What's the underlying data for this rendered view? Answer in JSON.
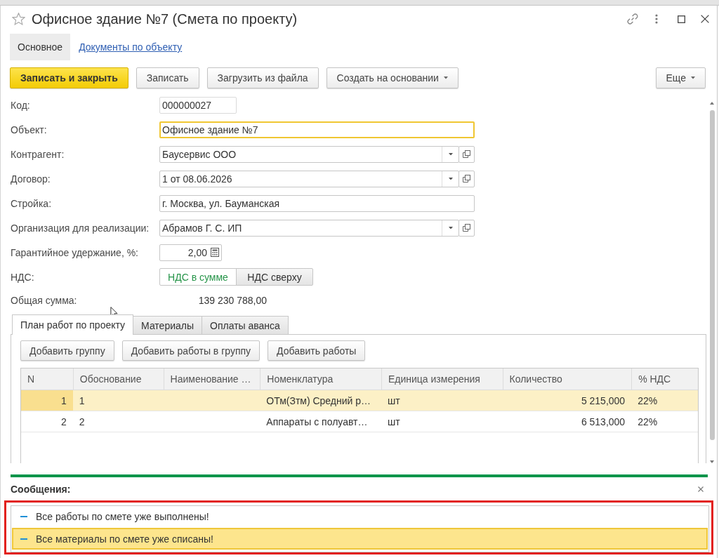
{
  "window": {
    "title": "Офисное здание №7 (Смета по проекту)",
    "favorite": false
  },
  "form_tabs": [
    {
      "label": "Основное",
      "selected": true
    },
    {
      "label": "Документы по объекту",
      "selected": false
    }
  ],
  "toolbar": {
    "buttons": [
      {
        "label": "Записать и закрыть",
        "kind": "primary"
      },
      {
        "label": "Записать",
        "kind": "plain"
      },
      {
        "label": "Загрузить из файла",
        "kind": "plain"
      },
      {
        "label": "Создать на основании",
        "kind": "menu"
      }
    ],
    "more": {
      "label": "Еще",
      "kind": "menu"
    }
  },
  "fields": [
    {
      "label": "Код:",
      "kind": "short",
      "value": "000000027",
      "focused": false
    },
    {
      "label": "Объект:",
      "kind": "text",
      "value": "Офисное здание №7",
      "focused": true
    },
    {
      "label": "Контрагент:",
      "kind": "select",
      "value": "Баусервис ООО",
      "focused": false
    },
    {
      "label": "Договор:",
      "kind": "select",
      "value": "1 от 08.06.2026",
      "focused": false
    },
    {
      "label": "Стройка:",
      "kind": "text",
      "value": "г. Москва, ул. Бауманская",
      "focused": false
    },
    {
      "label": "Организация для реализации:",
      "kind": "select",
      "value": "Абрамов Г. С. ИП",
      "focused": false
    },
    {
      "label": "Гарантийное удержание, %:",
      "kind": "number",
      "value": "2,00",
      "focused": false
    },
    {
      "label": "НДС:",
      "kind": "toggle",
      "options": [
        {
          "label": "НДС в сумме",
          "selected": true
        },
        {
          "label": "НДС сверху",
          "selected": false
        }
      ]
    },
    {
      "label": "Общая сумма:",
      "kind": "total",
      "value": "139 230 788,00"
    }
  ],
  "tabs": [
    {
      "label": "План работ по проекту",
      "selected": true
    },
    {
      "label": "Материалы",
      "selected": false
    },
    {
      "label": "Оплаты аванса",
      "selected": false
    }
  ],
  "tab_buttons": [
    "Добавить группу",
    "Добавить работы в группу",
    "Добавить работы"
  ],
  "table": {
    "columns": [
      "N",
      "Обоснование",
      "Наименование …",
      "Номенклатура",
      "Единица измерения",
      "Количество",
      "% НДС"
    ],
    "rows": [
      {
        "n": "1",
        "basis": "1",
        "nomenclature": "ОТм(Зтм) Средний р…",
        "unit": "шт",
        "quantity": "5 215,000",
        "vat": "22%",
        "selected": true
      },
      {
        "n": "2",
        "basis": "2",
        "nomenclature": "Аппараты с полуавт…",
        "unit": "шт",
        "quantity": "6 513,000",
        "vat": "22%",
        "selected": false
      }
    ]
  },
  "messages": {
    "title": "Сообщения:",
    "highlighted": true,
    "items": [
      {
        "text": "Все работы по смете уже выполнены!",
        "selected": false
      },
      {
        "text": "Все материалы по смете уже списаны!",
        "selected": true
      }
    ]
  }
}
